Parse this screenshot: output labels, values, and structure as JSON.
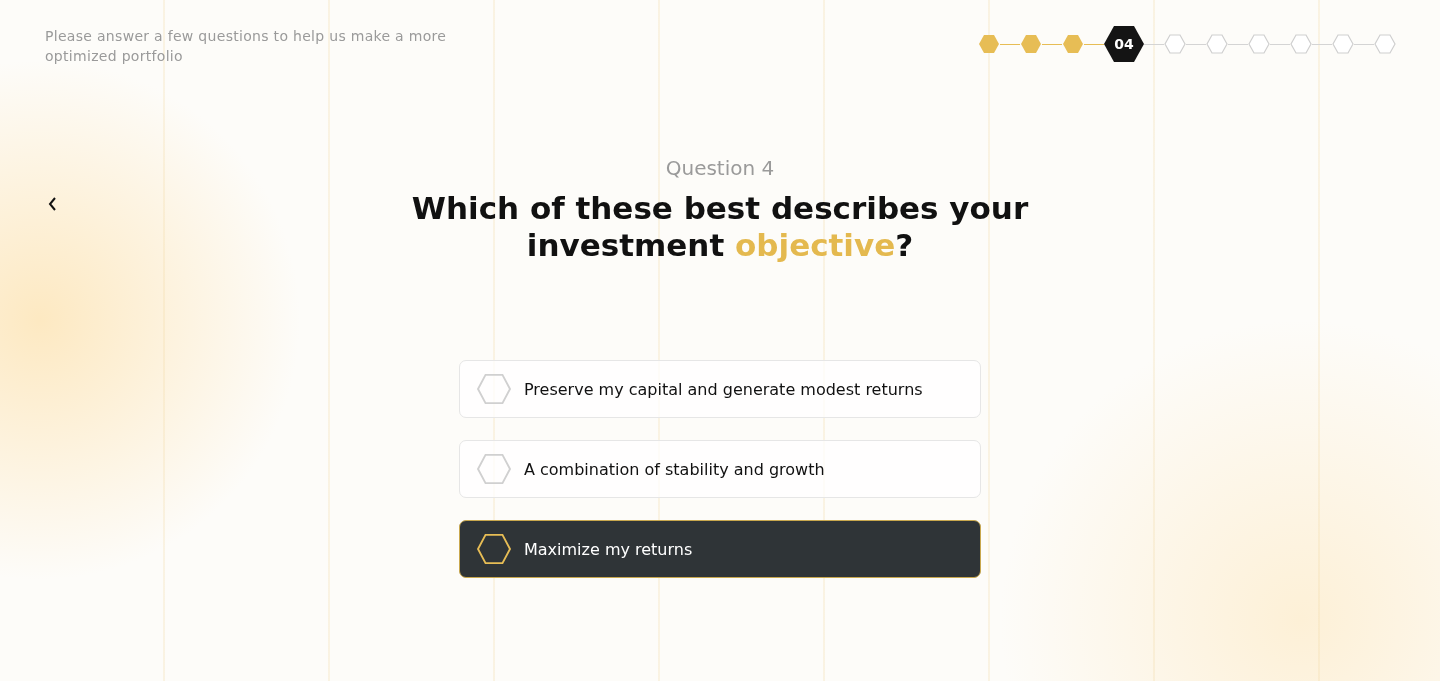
{
  "intro": "Please answer a few questions to help us make a more optimized portfolio",
  "steps": [
    {
      "completed": true,
      "current": false
    },
    {
      "completed": true,
      "current": false
    },
    {
      "completed": true,
      "current": false
    },
    {
      "completed": false,
      "current": true,
      "label": "04"
    },
    {
      "completed": false,
      "current": false
    },
    {
      "completed": false,
      "current": false
    },
    {
      "completed": false,
      "current": false
    },
    {
      "completed": false,
      "current": false
    },
    {
      "completed": false,
      "current": false
    },
    {
      "completed": false,
      "current": false
    }
  ],
  "question": {
    "number": "Question 4",
    "title": "Which of these best describes your investment ",
    "title_highlight": "objective",
    "title_end": "?"
  },
  "options": [
    {
      "label": "Preserve my capital and generate modest returns",
      "selected": false
    },
    {
      "label": "A combination of stability and growth",
      "selected": false
    },
    {
      "label": "Maximize my returns",
      "selected": true
    }
  ]
}
